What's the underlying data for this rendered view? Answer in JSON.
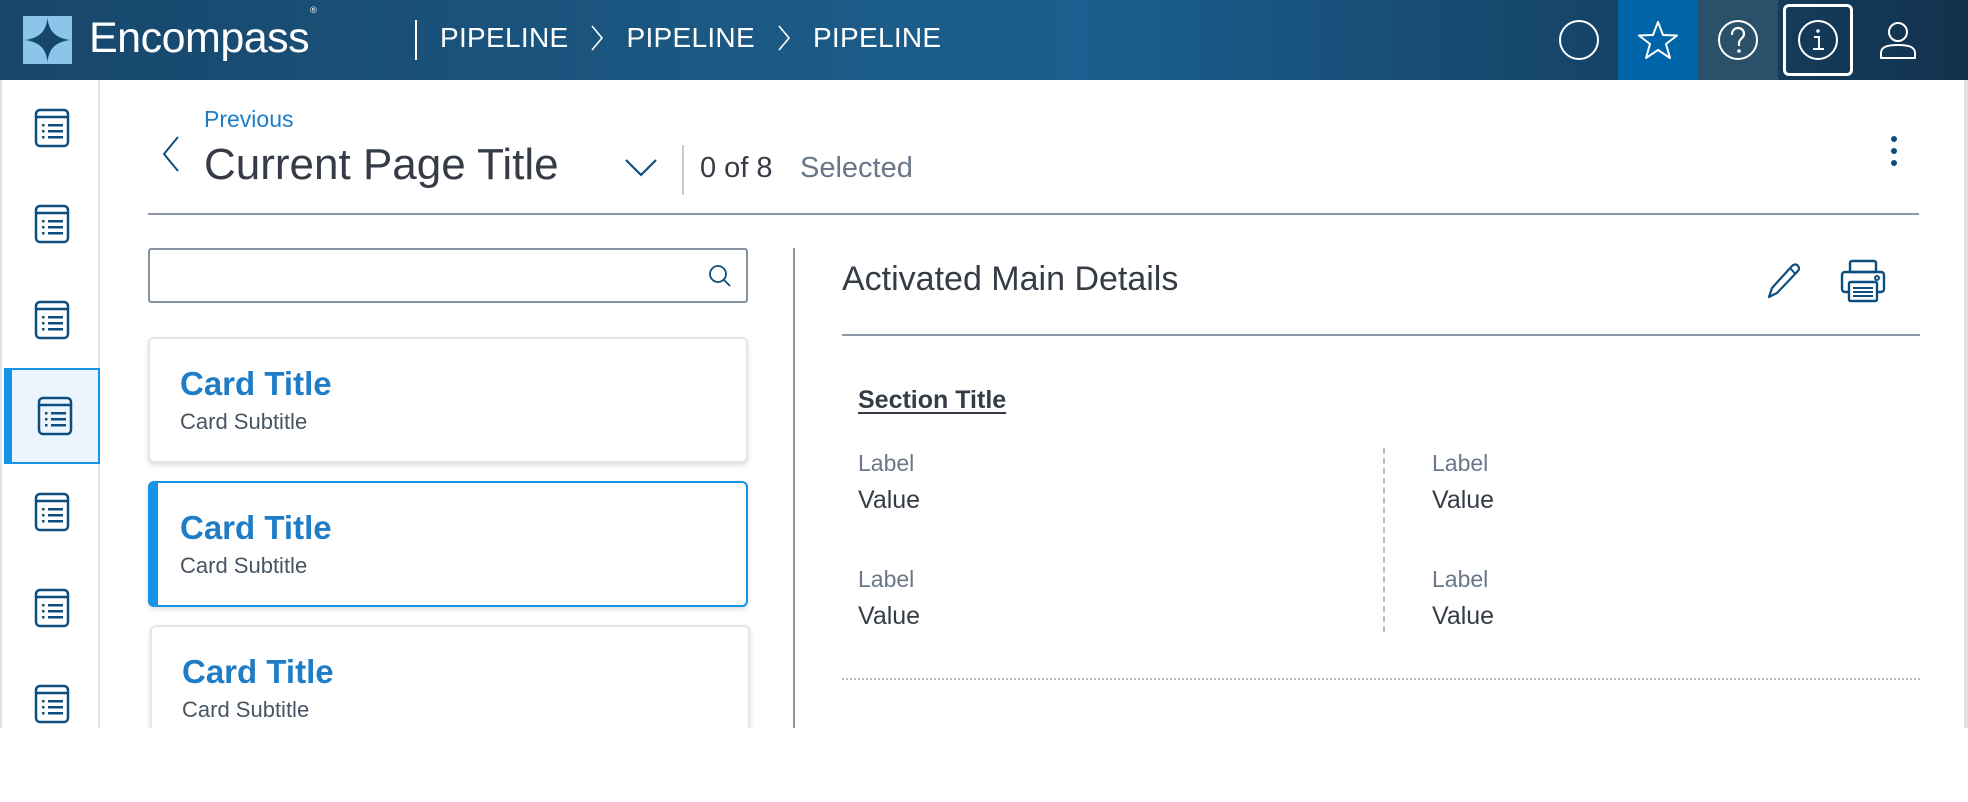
{
  "header": {
    "brand": "Encompass",
    "brand_mark": "®",
    "breadcrumbs": [
      "PIPELINE",
      "PIPELINE",
      "PIPELINE"
    ],
    "buttons": [
      {
        "name": "circle-icon"
      },
      {
        "name": "star-icon",
        "active": true
      },
      {
        "name": "help-icon"
      },
      {
        "name": "info-icon",
        "focused": true
      },
      {
        "name": "user-icon"
      }
    ],
    "colors": {
      "bar": "#1a5f8f",
      "active_button": "#0064a8"
    }
  },
  "rail": {
    "items": [
      {
        "icon": "list-icon",
        "active": false
      },
      {
        "icon": "list-icon",
        "active": false
      },
      {
        "icon": "list-icon",
        "active": false
      },
      {
        "icon": "list-icon",
        "active": true
      },
      {
        "icon": "list-icon",
        "active": false
      },
      {
        "icon": "list-icon",
        "active": false
      },
      {
        "icon": "list-icon",
        "active": false
      }
    ]
  },
  "page": {
    "previous_label": "Previous",
    "title": "Current Page Title",
    "selection_count": "0 of 8",
    "selection_label": "Selected"
  },
  "search": {
    "value": "",
    "placeholder": ""
  },
  "cards": [
    {
      "title": "Card Title",
      "subtitle": "Card Subtitle",
      "selected": false
    },
    {
      "title": "Card Title",
      "subtitle": "Card Subtitle",
      "selected": true
    },
    {
      "title": "Card Title",
      "subtitle": "Card Subtitle",
      "selected": false
    }
  ],
  "detail": {
    "title": "Activated Main Details",
    "section_title": "Section Title",
    "fields": [
      {
        "label": "Label",
        "value": "Value"
      },
      {
        "label": "Label",
        "value": "Value"
      },
      {
        "label": "Label",
        "value": "Value"
      },
      {
        "label": "Label",
        "value": "Value"
      }
    ]
  },
  "colors": {
    "accent": "#1394e5",
    "link": "#1e7dc6",
    "icon": "#0c4f7f",
    "text": "#353c46",
    "muted": "#697789"
  }
}
